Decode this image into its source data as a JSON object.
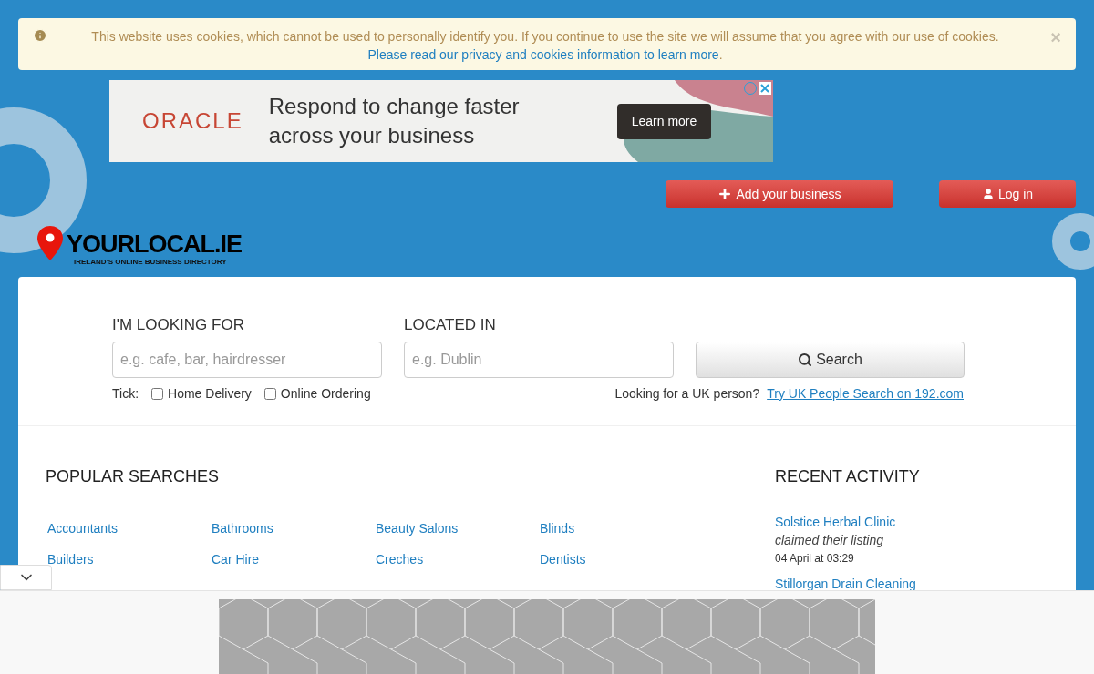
{
  "cookie_notice": {
    "text": "This website uses cookies, which cannot be used to personally identify you. If you continue to use the site we will assume that you agree with our use of cookies.",
    "link": "Please read our privacy and cookies information to learn more",
    "end": ".",
    "close": "×"
  },
  "ad_banner": {
    "brand": "ORACLE",
    "headline": "Respond to change faster across your business",
    "button": "Learn more"
  },
  "header_buttons": [
    {
      "label": "Add your business"
    },
    {
      "label": "Log in"
    }
  ],
  "logo": {
    "name": "YOURLOCAL.IE",
    "tagline": "IRELAND’S ONLINE BUSINESS DIRECTORY"
  },
  "search": {
    "what_label": "I'M LOOKING FOR",
    "what_placeholder": "e.g. cafe, bar, hairdresser",
    "where_label": "LOCATED IN",
    "where_placeholder": "e.g. Dublin",
    "button": "Search",
    "tick_label": "Tick:",
    "options": [
      {
        "label": "Home Delivery",
        "checked": false
      },
      {
        "label": "Online Ordering",
        "checked": false
      }
    ],
    "uk_text": "Looking for a UK person?",
    "uk_link": "Try UK People Search on 192.com"
  },
  "popular": {
    "title": "POPULAR SEARCHES",
    "items": [
      "Accountants",
      "Bathrooms",
      "Beauty Salons",
      "Blinds",
      "Builders",
      "Car Hire",
      "Creches",
      "Dentists"
    ]
  },
  "recent": {
    "title": "RECENT ACTIVITY",
    "items": [
      {
        "name": "Solstice Herbal Clinic",
        "action": "claimed their listing",
        "time": "04 April at 03:29"
      },
      {
        "name": "Stillorgan Drain Cleaning"
      }
    ]
  }
}
